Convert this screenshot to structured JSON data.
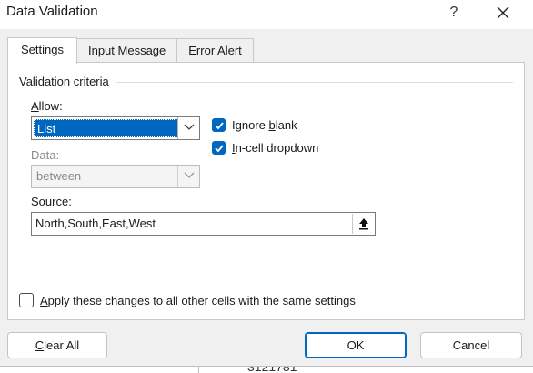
{
  "window": {
    "title": "Data Validation",
    "help_label": "?",
    "close_label": "✕"
  },
  "tabs": [
    {
      "label": "Settings",
      "active": true
    },
    {
      "label": "Input Message",
      "active": false
    },
    {
      "label": "Error Alert",
      "active": false
    }
  ],
  "validation": {
    "group_label": "Validation criteria",
    "allow_label_key": "A",
    "allow_label_rest": "llow:",
    "allow_value": "List",
    "data_label": "Data:",
    "data_value": "between",
    "source_label_key": "S",
    "source_label_rest": "ource:",
    "source_value": "North,South,East,West",
    "ignore_blank": {
      "pre": "Ignore ",
      "key": "b",
      "post": "lank",
      "checked": true
    },
    "incell_dropdown": {
      "pre": "",
      "key": "I",
      "post": "n-cell dropdown",
      "checked": true
    },
    "apply_all": {
      "pre": "",
      "key": "A",
      "post": "pply these changes to all other cells with the same settings",
      "checked": false
    }
  },
  "footer": {
    "clear_key": "C",
    "clear_rest": "lear All",
    "ok_label": "OK",
    "cancel_label": "Cancel"
  },
  "background_fragment": "3121781"
}
